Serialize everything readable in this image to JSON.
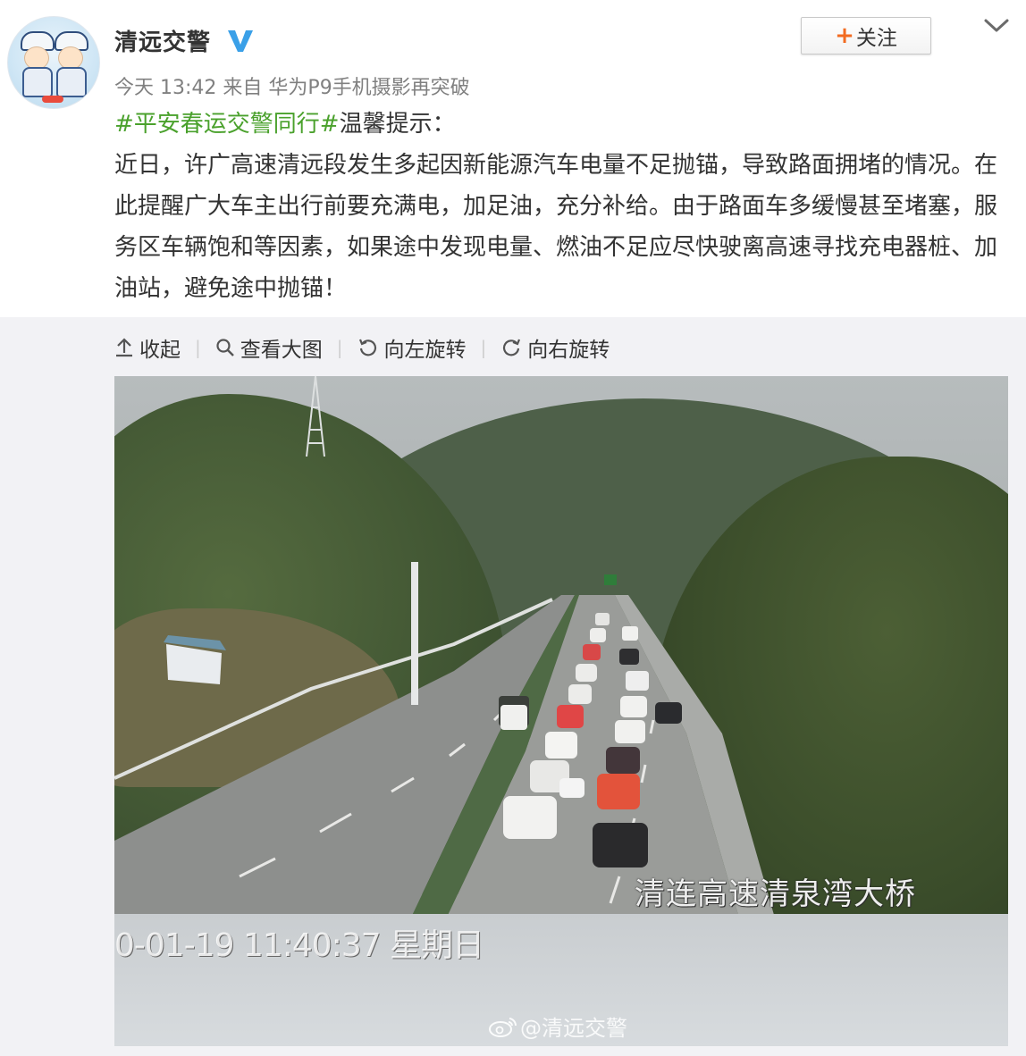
{
  "post": {
    "username": "清远交警",
    "verified_icon": "verified-v-icon",
    "time": "今天 13:42",
    "source_prefix": "来自",
    "source": "华为P9手机摄影再突破",
    "follow_label": "关注",
    "topic": "#平安春运交警同行#",
    "intro": "温馨提示：",
    "body": "近日，许广高速清远段发生多起因新能源汽车电量不足抛锚，导致路面拥堵的情况。在此提醒广大车主出行前要充满电，加足油，充分补给。由于路面车多缓慢甚至堵塞，服务区车辆饱和等因素，如果途中发现电量、燃油不足应尽快驶离高速寻找充电器桩、加油站，避免途中抛锚！"
  },
  "toolbar": {
    "collapse": "收起",
    "view_large": "查看大图",
    "rotate_left": "向左旋转",
    "rotate_right": "向右旋转"
  },
  "photo": {
    "location_overlay": "清连高速清泉湾大桥",
    "timestamp_overlay": "0-01-19 11:40:37 星期日",
    "watermark": "@清远交警"
  },
  "colors": {
    "topic": "#4aa12c",
    "follow_plus": "#f26b21",
    "verified": "#3aa0e8"
  }
}
